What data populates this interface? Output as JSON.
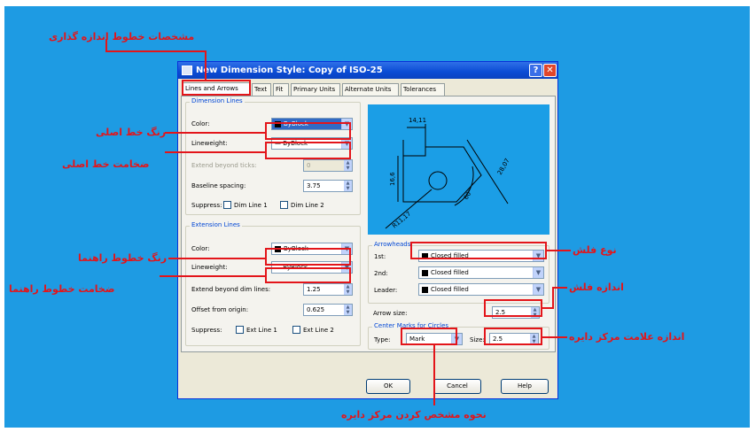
{
  "window": {
    "title": "New Dimension Style: Copy of ISO-25",
    "help_glyph": "?",
    "close_glyph": "✕"
  },
  "tabs": [
    "Lines and Arrows",
    "Text",
    "Fit",
    "Primary Units",
    "Alternate Units",
    "Tolerances"
  ],
  "dimension_lines": {
    "group_title": "Dimension Lines",
    "color_label": "Color:",
    "color_value": "ByBlock",
    "lineweight_label": "Lineweight:",
    "lineweight_value": "— ByBlock",
    "extend_label": "Extend beyond ticks:",
    "extend_value": "0",
    "baseline_label": "Baseline spacing:",
    "baseline_value": "3.75",
    "suppress_label": "Suppress:",
    "dim1_label": "Dim Line 1",
    "dim2_label": "Dim Line 2"
  },
  "extension_lines": {
    "group_title": "Extension Lines",
    "color_label": "Color:",
    "color_value": "ByBlock",
    "lineweight_label": "Lineweight:",
    "lineweight_value": "— ByBlock",
    "extend_label": "Extend beyond dim lines:",
    "extend_value": "1.25",
    "offset_label": "Offset from origin:",
    "offset_value": "0.625",
    "suppress_label": "Suppress:",
    "ext1_label": "Ext Line 1",
    "ext2_label": "Ext Line 2"
  },
  "preview": {
    "dim_top": "14,11",
    "dim_left": "16,6",
    "dim_right": "28,07",
    "dim_angle": "60°",
    "dim_radius": "R11,17"
  },
  "arrowheads": {
    "group_title": "Arrowheads",
    "first_label": "1st:",
    "first_value": "Closed filled",
    "second_label": "2nd:",
    "second_value": "Closed filled",
    "leader_label": "Leader:",
    "leader_value": "Closed filled",
    "size_label": "Arrow size:",
    "size_value": "2.5"
  },
  "center_marks": {
    "group_title": "Center Marks for Circles",
    "type_label": "Type:",
    "type_value": "Mark",
    "size_label": "Size:",
    "size_value": "2.5"
  },
  "buttons": {
    "ok": "OK",
    "cancel": "Cancel",
    "help": "Help"
  },
  "annotations": {
    "dim_line_properties": "مشخصات خطوط اندازه گذاری",
    "main_line_color": "رنگ خط اصلی",
    "main_line_weight": "ضخامت خط اصلی",
    "ext_line_color": "رنگ خطوط راهنما",
    "ext_line_weight": "ضخامت خطوط راهنما",
    "arrow_type": "نوع فلش",
    "arrow_size": "اندازه فلش",
    "center_mark_size": "اندازه علامت مرکز دایره",
    "center_mark_type": "نحوه مشخص کردن مرکز دایره"
  },
  "colors": {
    "annotation_red": "#e3151a",
    "background_blue": "#1e9be3"
  }
}
